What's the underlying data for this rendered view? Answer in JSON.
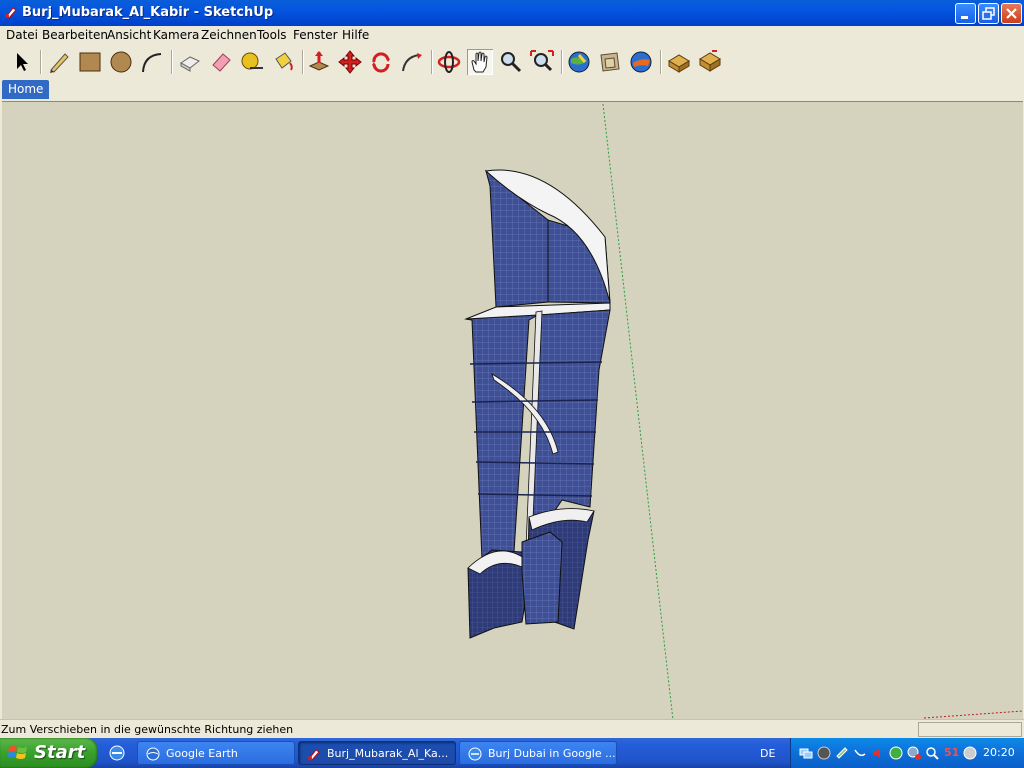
{
  "window": {
    "title": "Burj_Mubarak_Al_Kabir - SketchUp"
  },
  "menu": [
    "Datei",
    "Bearbeiten",
    "Ansicht",
    "Kamera",
    "Zeichnen",
    "Tools",
    "Fenster",
    "Hilfe"
  ],
  "toolbar": {
    "tools": [
      "select-icon",
      "pencil-icon",
      "rectangle-icon",
      "circle-icon",
      "arc-icon",
      "make-component-icon",
      "eraser-icon",
      "tape-measure-icon",
      "paint-bucket-icon",
      "push-pull-icon",
      "move-icon",
      "rotate-icon",
      "follow-me-icon",
      "orbit-icon",
      "pan-icon",
      "zoom-icon",
      "zoom-extents-icon",
      "get-models-icon",
      "share-model-icon",
      "google-earth-icon",
      "warehouse-icon",
      "component-icon"
    ]
  },
  "tabs": {
    "home": "Home"
  },
  "status": {
    "text": "Zum Verschieben in die gewünschte Richtung ziehen"
  },
  "taskbar": {
    "start": "Start",
    "items": [
      {
        "label": "Google Earth"
      },
      {
        "label": "Burj_Mubarak_Al_Ka..."
      },
      {
        "label": "Burj Dubai in Google ..."
      }
    ],
    "lang": "DE",
    "tray_number": "51",
    "clock": "20:20"
  },
  "colors": {
    "titlebar": "#0454e0",
    "viewport": "#d5d2be",
    "taskbar": "#245edb",
    "start": "#37a12a",
    "building": "#3e4f95"
  }
}
